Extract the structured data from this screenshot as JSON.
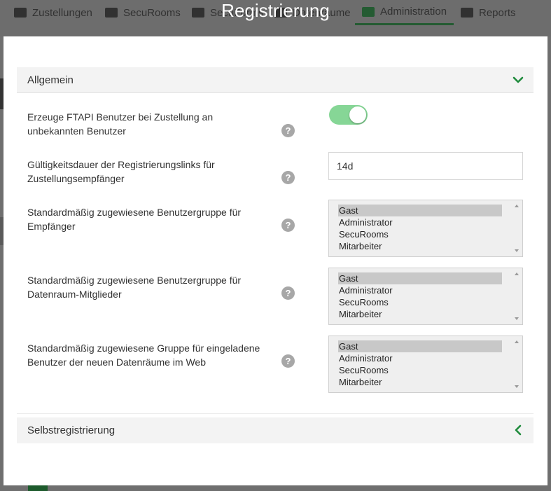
{
  "background_nav": {
    "items": [
      {
        "label": "Zustellungen"
      },
      {
        "label": "SecuRooms"
      },
      {
        "label": "SecuForms"
      },
      {
        "label": "Datenräume"
      },
      {
        "label": "Administration"
      },
      {
        "label": "Reports"
      }
    ],
    "active_index": 4
  },
  "modal": {
    "title": "Registrierung",
    "sections": {
      "general": {
        "title": "Allgemein",
        "expanded": true
      },
      "self_registration": {
        "title": "Selbstregistrierung",
        "expanded": false
      }
    },
    "settings": {
      "create_ftapi_user": {
        "label": "Erzeuge FTAPI Benutzer bei Zustellung an unbekannten Benutzer",
        "enabled": true
      },
      "link_validity": {
        "label": "Gültigkeitsdauer der Registrierungslinks für Zustellungsempfänger",
        "value": "14d"
      },
      "recipient_group": {
        "label": "Standardmäßig zugewiesene Benutzergruppe für Empfänger",
        "options": [
          "Gast",
          "Administrator",
          "SecuRooms",
          "Mitarbeiter"
        ],
        "selected": "Gast"
      },
      "dataroom_member_group": {
        "label": "Standardmäßig zugewiesene Benutzergruppe für Datenraum-Mitglieder",
        "options": [
          "Gast",
          "Administrator",
          "SecuRooms",
          "Mitarbeiter"
        ],
        "selected": "Gast"
      },
      "invited_web_group": {
        "label": "Standardmäßig zugewiesene Gruppe für eingeladene Benutzer der neuen Datenräume im Web",
        "options": [
          "Gast",
          "Administrator",
          "SecuRooms",
          "Mitarbeiter"
        ],
        "selected": "Gast"
      }
    },
    "help_icon_glyph": "?",
    "colors": {
      "accent_green": "#1d8a3a",
      "toggle_on": "#86d696",
      "header_bg": "#f3f3f3"
    }
  }
}
